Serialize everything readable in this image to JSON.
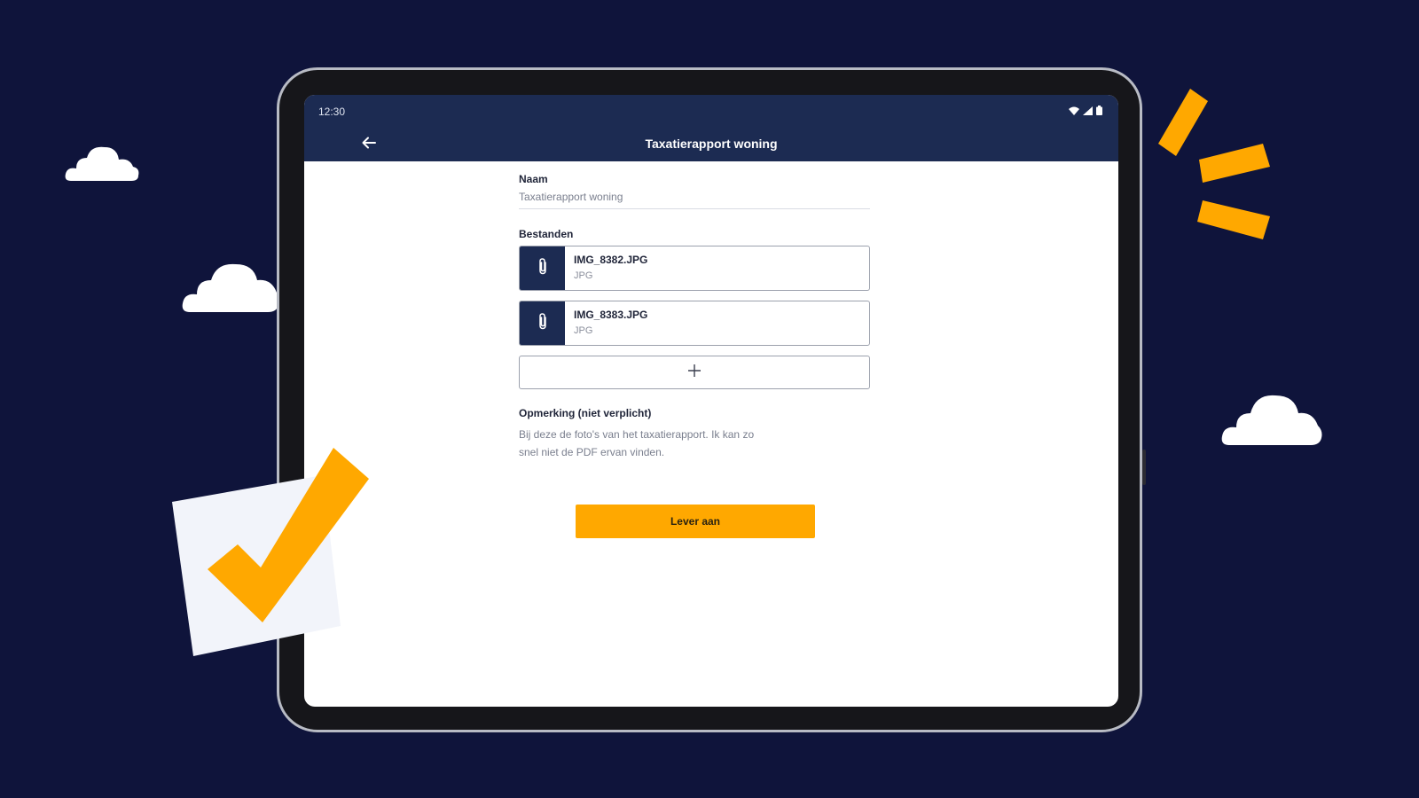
{
  "colors": {
    "background": "#0f143b",
    "app_bar": "#1c2b52",
    "accent": "#ffa800",
    "screen": "#ffffff"
  },
  "status_bar": {
    "time": "12:30",
    "icons": [
      "wifi-icon",
      "signal-icon",
      "battery-icon"
    ]
  },
  "app_bar": {
    "back_icon": "arrow-left-icon",
    "title": "Taxatierapport woning"
  },
  "form": {
    "name": {
      "label": "Naam",
      "value": "Taxatierapport woning"
    },
    "files": {
      "label": "Bestanden",
      "items": [
        {
          "name": "IMG_8382.JPG",
          "type": "JPG",
          "icon": "paperclip-icon"
        },
        {
          "name": "IMG_8383.JPG",
          "type": "JPG",
          "icon": "paperclip-icon"
        }
      ],
      "add_icon": "plus-icon"
    },
    "remark": {
      "label": "Opmerking (niet verplicht)",
      "value": "Bij deze de foto's van het taxatierapport. Ik kan zo snel niet de PDF ervan vinden."
    },
    "submit_label": "Lever aan"
  },
  "decorations": {
    "checkmark_icon": "checkmark-icon",
    "burst_icon": "sparkle-burst-icon",
    "cloud_icon": "cloud-icon"
  }
}
